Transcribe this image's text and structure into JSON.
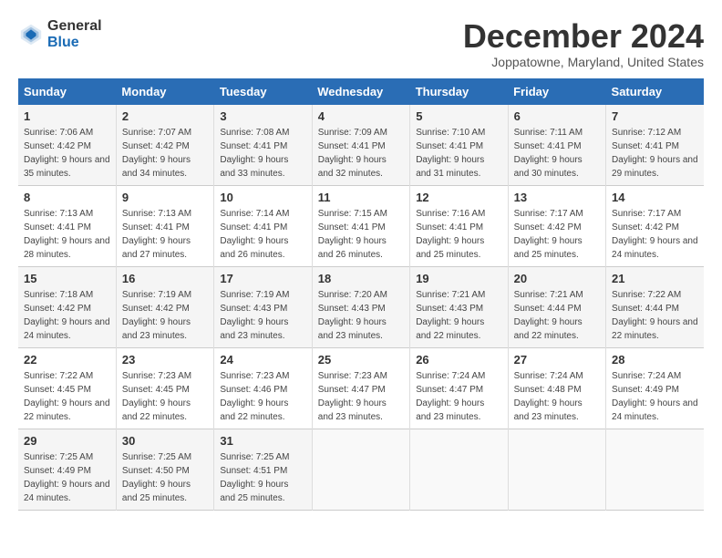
{
  "logo": {
    "general": "General",
    "blue": "Blue"
  },
  "title": "December 2024",
  "subtitle": "Joppatowne, Maryland, United States",
  "header": {
    "days": [
      "Sunday",
      "Monday",
      "Tuesday",
      "Wednesday",
      "Thursday",
      "Friday",
      "Saturday"
    ]
  },
  "weeks": [
    [
      {
        "day": "1",
        "sunrise": "Sunrise: 7:06 AM",
        "sunset": "Sunset: 4:42 PM",
        "daylight": "Daylight: 9 hours and 35 minutes."
      },
      {
        "day": "2",
        "sunrise": "Sunrise: 7:07 AM",
        "sunset": "Sunset: 4:42 PM",
        "daylight": "Daylight: 9 hours and 34 minutes."
      },
      {
        "day": "3",
        "sunrise": "Sunrise: 7:08 AM",
        "sunset": "Sunset: 4:41 PM",
        "daylight": "Daylight: 9 hours and 33 minutes."
      },
      {
        "day": "4",
        "sunrise": "Sunrise: 7:09 AM",
        "sunset": "Sunset: 4:41 PM",
        "daylight": "Daylight: 9 hours and 32 minutes."
      },
      {
        "day": "5",
        "sunrise": "Sunrise: 7:10 AM",
        "sunset": "Sunset: 4:41 PM",
        "daylight": "Daylight: 9 hours and 31 minutes."
      },
      {
        "day": "6",
        "sunrise": "Sunrise: 7:11 AM",
        "sunset": "Sunset: 4:41 PM",
        "daylight": "Daylight: 9 hours and 30 minutes."
      },
      {
        "day": "7",
        "sunrise": "Sunrise: 7:12 AM",
        "sunset": "Sunset: 4:41 PM",
        "daylight": "Daylight: 9 hours and 29 minutes."
      }
    ],
    [
      {
        "day": "8",
        "sunrise": "Sunrise: 7:13 AM",
        "sunset": "Sunset: 4:41 PM",
        "daylight": "Daylight: 9 hours and 28 minutes."
      },
      {
        "day": "9",
        "sunrise": "Sunrise: 7:13 AM",
        "sunset": "Sunset: 4:41 PM",
        "daylight": "Daylight: 9 hours and 27 minutes."
      },
      {
        "day": "10",
        "sunrise": "Sunrise: 7:14 AM",
        "sunset": "Sunset: 4:41 PM",
        "daylight": "Daylight: 9 hours and 26 minutes."
      },
      {
        "day": "11",
        "sunrise": "Sunrise: 7:15 AM",
        "sunset": "Sunset: 4:41 PM",
        "daylight": "Daylight: 9 hours and 26 minutes."
      },
      {
        "day": "12",
        "sunrise": "Sunrise: 7:16 AM",
        "sunset": "Sunset: 4:41 PM",
        "daylight": "Daylight: 9 hours and 25 minutes."
      },
      {
        "day": "13",
        "sunrise": "Sunrise: 7:17 AM",
        "sunset": "Sunset: 4:42 PM",
        "daylight": "Daylight: 9 hours and 25 minutes."
      },
      {
        "day": "14",
        "sunrise": "Sunrise: 7:17 AM",
        "sunset": "Sunset: 4:42 PM",
        "daylight": "Daylight: 9 hours and 24 minutes."
      }
    ],
    [
      {
        "day": "15",
        "sunrise": "Sunrise: 7:18 AM",
        "sunset": "Sunset: 4:42 PM",
        "daylight": "Daylight: 9 hours and 24 minutes."
      },
      {
        "day": "16",
        "sunrise": "Sunrise: 7:19 AM",
        "sunset": "Sunset: 4:42 PM",
        "daylight": "Daylight: 9 hours and 23 minutes."
      },
      {
        "day": "17",
        "sunrise": "Sunrise: 7:19 AM",
        "sunset": "Sunset: 4:43 PM",
        "daylight": "Daylight: 9 hours and 23 minutes."
      },
      {
        "day": "18",
        "sunrise": "Sunrise: 7:20 AM",
        "sunset": "Sunset: 4:43 PM",
        "daylight": "Daylight: 9 hours and 23 minutes."
      },
      {
        "day": "19",
        "sunrise": "Sunrise: 7:21 AM",
        "sunset": "Sunset: 4:43 PM",
        "daylight": "Daylight: 9 hours and 22 minutes."
      },
      {
        "day": "20",
        "sunrise": "Sunrise: 7:21 AM",
        "sunset": "Sunset: 4:44 PM",
        "daylight": "Daylight: 9 hours and 22 minutes."
      },
      {
        "day": "21",
        "sunrise": "Sunrise: 7:22 AM",
        "sunset": "Sunset: 4:44 PM",
        "daylight": "Daylight: 9 hours and 22 minutes."
      }
    ],
    [
      {
        "day": "22",
        "sunrise": "Sunrise: 7:22 AM",
        "sunset": "Sunset: 4:45 PM",
        "daylight": "Daylight: 9 hours and 22 minutes."
      },
      {
        "day": "23",
        "sunrise": "Sunrise: 7:23 AM",
        "sunset": "Sunset: 4:45 PM",
        "daylight": "Daylight: 9 hours and 22 minutes."
      },
      {
        "day": "24",
        "sunrise": "Sunrise: 7:23 AM",
        "sunset": "Sunset: 4:46 PM",
        "daylight": "Daylight: 9 hours and 22 minutes."
      },
      {
        "day": "25",
        "sunrise": "Sunrise: 7:23 AM",
        "sunset": "Sunset: 4:47 PM",
        "daylight": "Daylight: 9 hours and 23 minutes."
      },
      {
        "day": "26",
        "sunrise": "Sunrise: 7:24 AM",
        "sunset": "Sunset: 4:47 PM",
        "daylight": "Daylight: 9 hours and 23 minutes."
      },
      {
        "day": "27",
        "sunrise": "Sunrise: 7:24 AM",
        "sunset": "Sunset: 4:48 PM",
        "daylight": "Daylight: 9 hours and 23 minutes."
      },
      {
        "day": "28",
        "sunrise": "Sunrise: 7:24 AM",
        "sunset": "Sunset: 4:49 PM",
        "daylight": "Daylight: 9 hours and 24 minutes."
      }
    ],
    [
      {
        "day": "29",
        "sunrise": "Sunrise: 7:25 AM",
        "sunset": "Sunset: 4:49 PM",
        "daylight": "Daylight: 9 hours and 24 minutes."
      },
      {
        "day": "30",
        "sunrise": "Sunrise: 7:25 AM",
        "sunset": "Sunset: 4:50 PM",
        "daylight": "Daylight: 9 hours and 25 minutes."
      },
      {
        "day": "31",
        "sunrise": "Sunrise: 7:25 AM",
        "sunset": "Sunset: 4:51 PM",
        "daylight": "Daylight: 9 hours and 25 minutes."
      },
      null,
      null,
      null,
      null
    ]
  ]
}
